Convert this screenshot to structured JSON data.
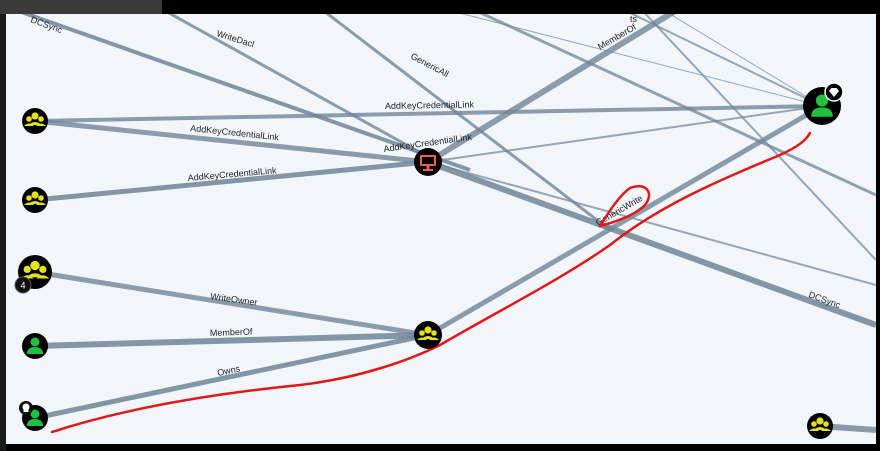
{
  "graph": {
    "edge_labels": {
      "dcsync_top": "DCSync",
      "writedacl": "WriteDacl",
      "genericall": "GenericAll",
      "memberof_top": "MemberOf",
      "top_right_partial": "ts",
      "addkey_1": "AddKeyCredentialLink",
      "addkey_2": "AddKeyCredentialLink",
      "addkey_3": "AddKeyCredentialLink",
      "addkey_4": "AddKeyCredentialLink",
      "genericwrite": "GenericWrite",
      "dcsync_right": "DCSync",
      "writeowner": "WriteOwner",
      "memberof_bottom": "MemberOf",
      "owns": "Owns"
    },
    "badge_count": "4",
    "colors": {
      "background": "#f2f6fb",
      "edge": "#6f8597",
      "node_fill": "#000000",
      "group_icon": "#e4e21a",
      "user_icon": "#1fc23c",
      "computer_icon": "#ef5d5d",
      "annotation_red": "#e01818"
    },
    "icons": [
      "group-icon",
      "user-icon",
      "computer-icon",
      "diamond-badge-icon",
      "skull-badge-icon"
    ]
  }
}
